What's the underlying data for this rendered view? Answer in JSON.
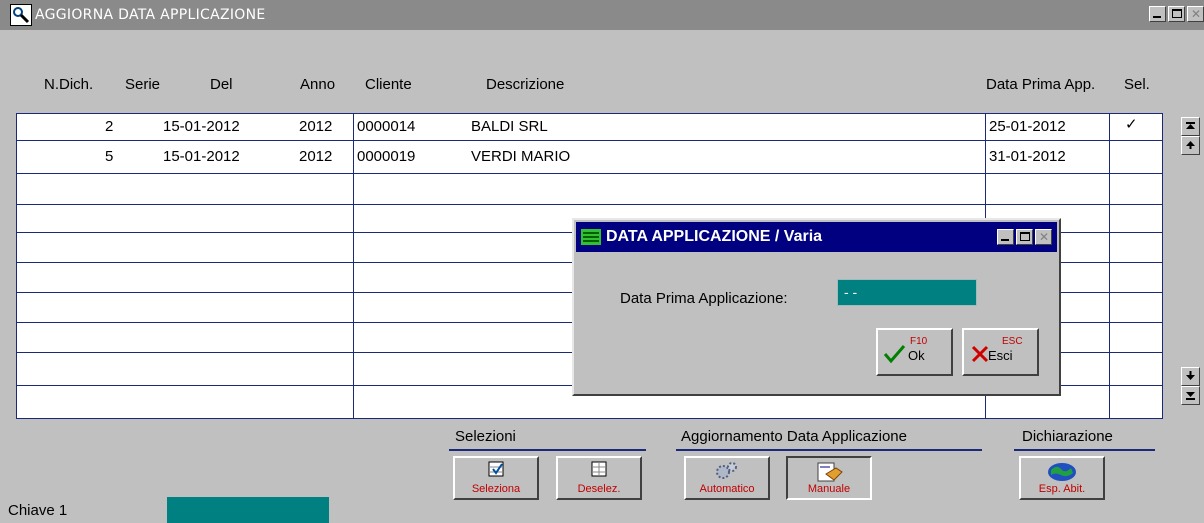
{
  "window": {
    "title": "AGGIORNA DATA APPLICAZIONE"
  },
  "columns": {
    "ndich": "N.Dich.",
    "serie": "Serie",
    "del": "Del",
    "anno": "Anno",
    "cliente": "Cliente",
    "descrizione": "Descrizione",
    "data_prima": "Data Prima App.",
    "sel": "Sel."
  },
  "rows": [
    {
      "ndich": "2",
      "del": "15-01-2012",
      "anno": "2012",
      "cliente": "0000014",
      "descrizione": "BALDI SRL",
      "data_prima": "25-01-2012",
      "sel": "✓"
    },
    {
      "ndich": "5",
      "del": "15-01-2012",
      "anno": "2012",
      "cliente": "0000019",
      "descrizione": "VERDI MARIO",
      "data_prima": "31-01-2012",
      "sel": ""
    }
  ],
  "groups": {
    "selezioni": "Selezioni",
    "aggiornamento": "Aggiornamento Data Applicazione",
    "dichiarazione": "Dichiarazione"
  },
  "buttons": {
    "seleziona": "Seleziona",
    "deselez": "Deselez.",
    "automatico": "Automatico",
    "manuale": "Manuale",
    "esp_abit": "Esp. Abit."
  },
  "footer": {
    "chiave_label": "Chiave 1"
  },
  "dialog": {
    "title": "DATA APPLICAZIONE / Varia",
    "field_label": "Data Prima Applicazione:",
    "field_value": "- -",
    "ok_key": "F10",
    "ok_label": "Ok",
    "esc_key": "ESC",
    "esc_label": "Esci"
  },
  "colors": {
    "grid_line": "#1a2a78",
    "teal_field": "#008080",
    "dialog_title": "#000080",
    "button_text": "#c00000"
  }
}
